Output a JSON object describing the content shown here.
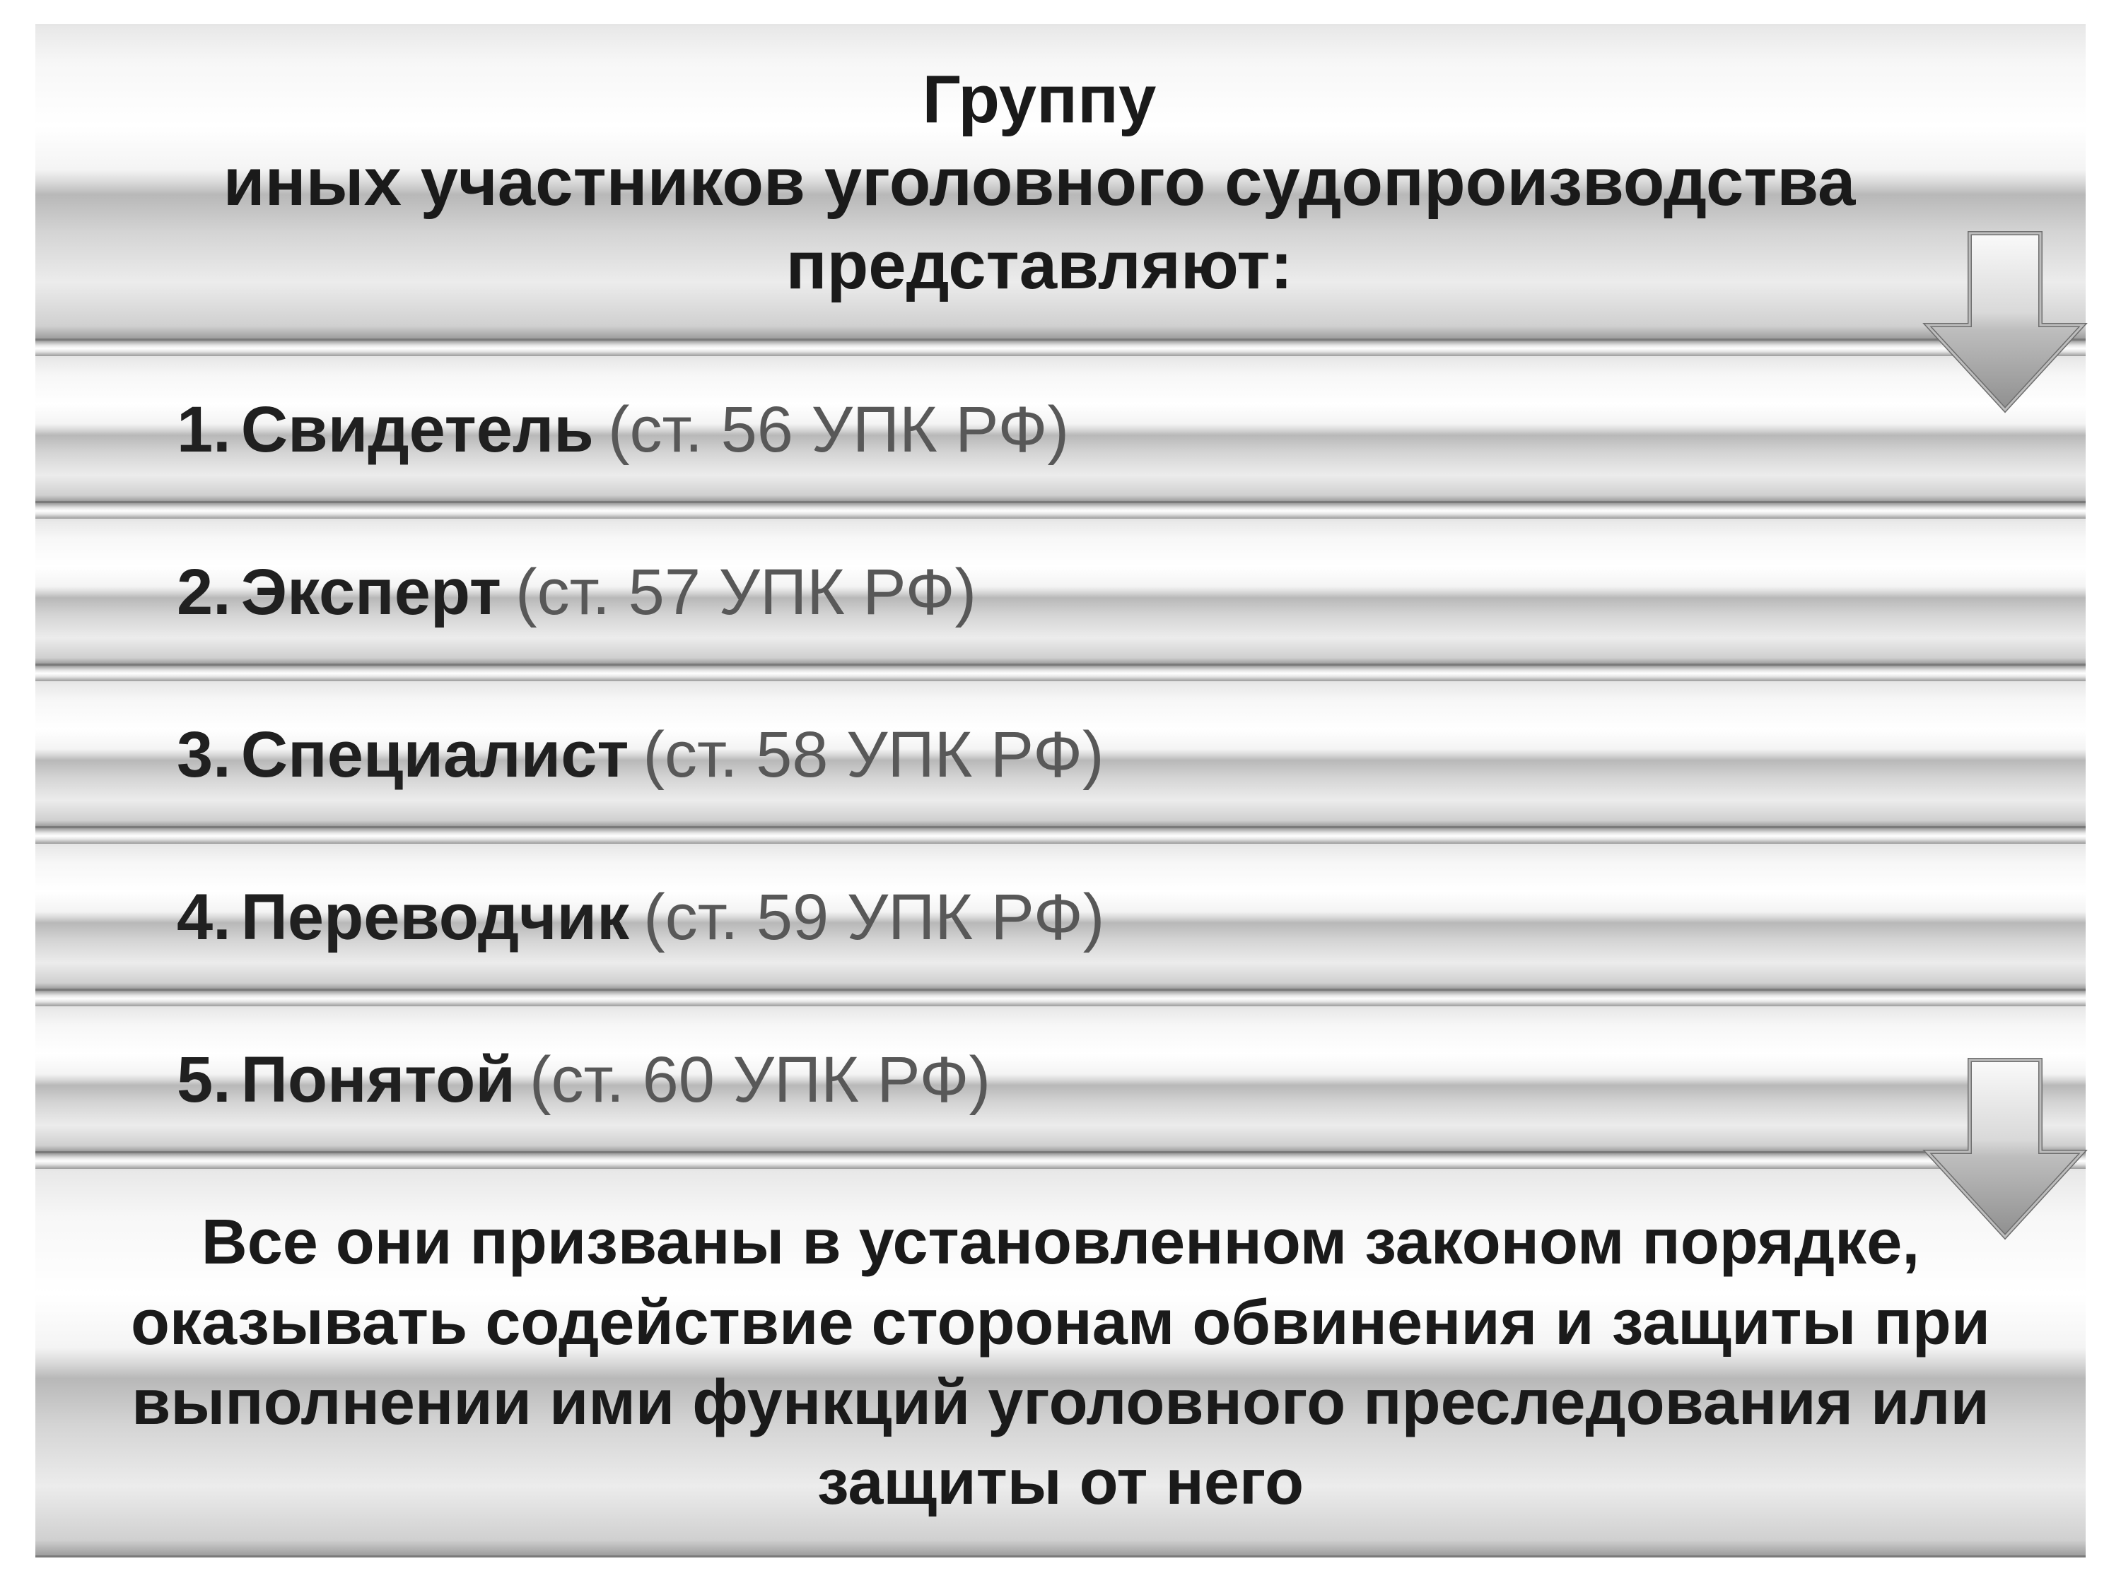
{
  "header": {
    "line1": "Группу",
    "line2": "иных участников уголовного судопроизводства",
    "line3": "представляют:"
  },
  "items": [
    {
      "num": "1.",
      "term": "Свидетель",
      "ref": "(ст. 56 УПК РФ)"
    },
    {
      "num": "2.",
      "term": "Эксперт",
      "ref": "(ст. 57 УПК РФ)"
    },
    {
      "num": "3.",
      "term": "Специалист",
      "ref": "(ст. 58 УПК РФ)"
    },
    {
      "num": "4.",
      "term": "Переводчик",
      "ref": "(ст. 59 УПК РФ)"
    },
    {
      "num": "5.",
      "term": "Понятой",
      "ref": "(ст. 60 УПК РФ)"
    }
  ],
  "footer": {
    "text": "Все они призваны в установленном законом порядке, оказывать содействие сторонам обвинения и защиты при выполнении ими функций уголовного преследования или защиты от него"
  }
}
